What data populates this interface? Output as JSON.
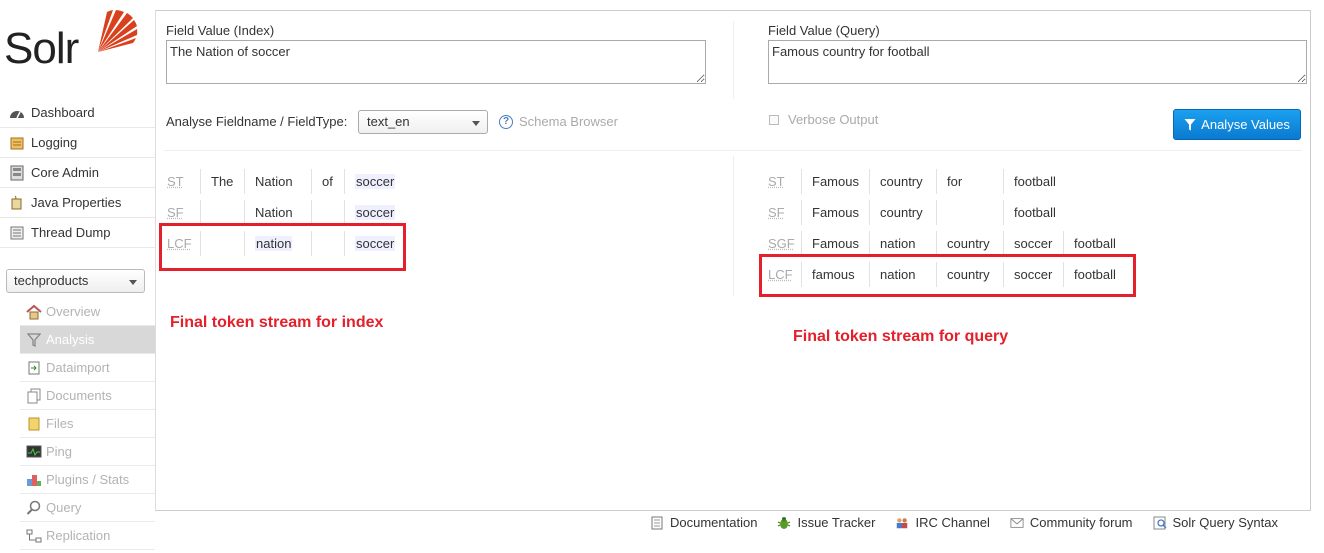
{
  "logo": {
    "text": "Solr"
  },
  "main_menu": [
    {
      "label": "Dashboard",
      "icon": "dashboard-icon"
    },
    {
      "label": "Logging",
      "icon": "logging-icon"
    },
    {
      "label": "Core Admin",
      "icon": "core-admin-icon"
    },
    {
      "label": "Java Properties",
      "icon": "java-properties-icon"
    },
    {
      "label": "Thread Dump",
      "icon": "thread-dump-icon"
    }
  ],
  "core_selector": {
    "value": "techproducts"
  },
  "core_menu": [
    {
      "label": "Overview",
      "icon": "home-icon"
    },
    {
      "label": "Analysis",
      "icon": "funnel-icon",
      "active": true
    },
    {
      "label": "Dataimport",
      "icon": "dataimport-icon"
    },
    {
      "label": "Documents",
      "icon": "documents-icon"
    },
    {
      "label": "Files",
      "icon": "files-icon"
    },
    {
      "label": "Ping",
      "icon": "ping-icon"
    },
    {
      "label": "Plugins / Stats",
      "icon": "plugins-icon"
    },
    {
      "label": "Query",
      "icon": "query-icon"
    },
    {
      "label": "Replication",
      "icon": "replication-icon"
    }
  ],
  "analysis": {
    "index_label": "Field Value (Index)",
    "index_value": "The Nation of soccer",
    "query_label": "Field Value (Query)",
    "query_value": "Famous country for football",
    "fieldtype_label": "Analyse Fieldname / FieldType:",
    "fieldtype_value": "text_en",
    "schema_browser": "Schema Browser",
    "verbose_output": "Verbose Output",
    "analyse_button": "Analyse Values"
  },
  "index_tokens": [
    {
      "stage": "ST",
      "tokens": [
        "The",
        "Nation",
        "of",
        "soccer"
      ]
    },
    {
      "stage": "SF",
      "tokens": [
        "",
        "Nation",
        "",
        "soccer"
      ]
    },
    {
      "stage": "LCF",
      "tokens": [
        "",
        "nation",
        "",
        "soccer"
      ]
    }
  ],
  "query_tokens": [
    {
      "stage": "ST",
      "tokens": [
        "Famous",
        "country",
        "for",
        "football"
      ]
    },
    {
      "stage": "SF",
      "tokens": [
        "Famous",
        "country",
        "",
        "football"
      ]
    },
    {
      "stage": "SGF",
      "tokens": [
        "Famous",
        "nation",
        "country",
        "soccer",
        "football"
      ]
    },
    {
      "stage": "LCF",
      "tokens": [
        "famous",
        "nation",
        "country",
        "soccer",
        "football"
      ]
    }
  ],
  "annotations": {
    "index": "Final token stream for index",
    "query": "Final token stream for query"
  },
  "footer": [
    {
      "label": "Documentation",
      "icon": "documentation-icon"
    },
    {
      "label": "Issue Tracker",
      "icon": "bug-icon"
    },
    {
      "label": "IRC Channel",
      "icon": "irc-icon"
    },
    {
      "label": "Community forum",
      "icon": "mail-icon"
    },
    {
      "label": "Solr Query Syntax",
      "icon": "query-syntax-icon"
    }
  ],
  "colors": {
    "accent": "#1a8fe3",
    "annotation": "#e3202b",
    "logo_red": "#d9411e"
  }
}
